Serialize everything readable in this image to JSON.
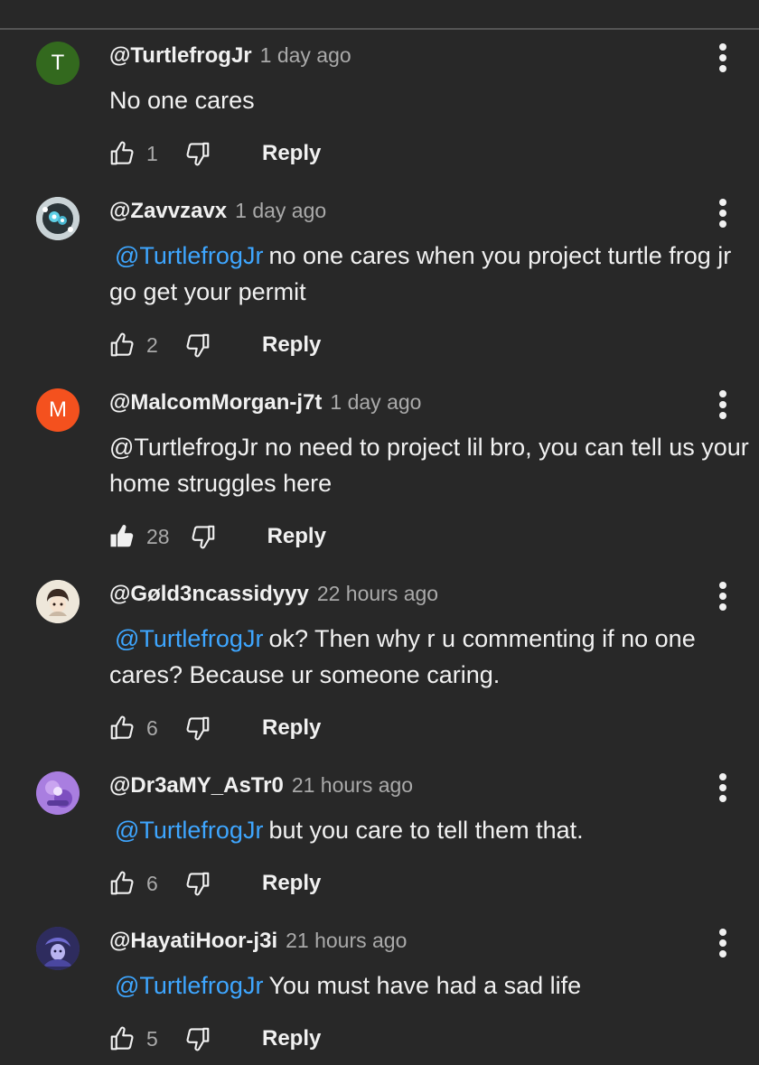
{
  "comments": [
    {
      "handle": "@TurtlefrogJr",
      "time": "1 day ago",
      "mention": "",
      "text": "No one cares",
      "likes": "1",
      "liked": false,
      "reply_label": "Reply",
      "avatar": {
        "type": "letter",
        "letter": "T",
        "color": "#33691e"
      }
    },
    {
      "handle": "@Zavvzavx",
      "time": "1 day ago",
      "mention": "@TurtlefrogJr",
      "text": "no one cares when you project turtle frog jr go get your permit",
      "likes": "2",
      "liked": false,
      "reply_label": "Reply",
      "avatar": {
        "type": "image",
        "color": "#6fa6b4"
      }
    },
    {
      "handle": "@MalcomMorgan-j7t",
      "time": "1 day ago",
      "mention": "",
      "text": "@TurtlefrogJr no need to project lil bro, you can tell us your home struggles here",
      "likes": "28",
      "liked": true,
      "reply_label": "Reply",
      "avatar": {
        "type": "letter",
        "letter": "M",
        "color": "#f4511e"
      }
    },
    {
      "handle": "@Gøld3ncassidyyy",
      "time": "22 hours ago",
      "mention": "@TurtlefrogJr",
      "text": "ok? Then why r u commenting if no one cares? Because ur someone caring.",
      "likes": "6",
      "liked": false,
      "reply_label": "Reply",
      "avatar": {
        "type": "image",
        "color": "#e8e0d2"
      }
    },
    {
      "handle": "@Dr3aMY_AsTr0",
      "time": "21 hours ago",
      "mention": "@TurtlefrogJr",
      "text": "but you care to tell them that.",
      "likes": "6",
      "liked": false,
      "reply_label": "Reply",
      "avatar": {
        "type": "image",
        "color": "#9b6fd6"
      }
    },
    {
      "handle": "@HayatiHoor-j3i",
      "time": "21 hours ago",
      "mention": "@TurtlefrogJr",
      "text": "You must have had a sad life",
      "likes": "5",
      "liked": false,
      "reply_label": "Reply",
      "avatar": {
        "type": "image",
        "color": "#3d3a78"
      }
    }
  ],
  "icons": {
    "like": "thumb-up-icon",
    "dislike": "thumb-down-icon",
    "more": "more-vert-icon"
  }
}
